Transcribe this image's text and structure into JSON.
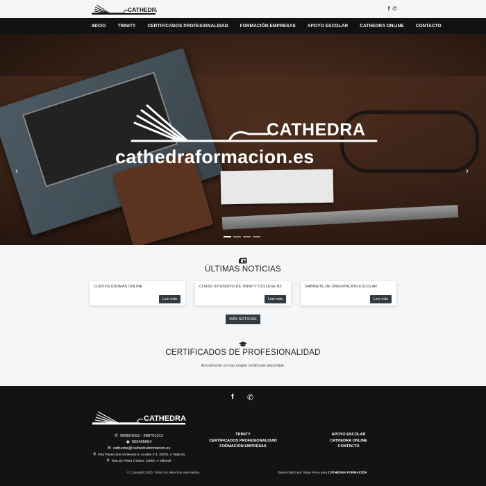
{
  "header": {
    "logo_text": "CATHEDRA",
    "social": [
      {
        "icon": "facebook-icon",
        "glyph": "f"
      },
      {
        "icon": "whatsapp-icon",
        "glyph": "✆"
      }
    ]
  },
  "nav": {
    "items": [
      {
        "label": "INICIO"
      },
      {
        "label": "TRINITY"
      },
      {
        "label": "CERTIFICADOS PROFESIONALIDAD"
      },
      {
        "label": "FORMACIÓN EMPRESAS"
      },
      {
        "label": "APOYO ESCOLAR"
      },
      {
        "label": "CATHEDRA ONLINE"
      },
      {
        "label": "CONTACTO"
      }
    ]
  },
  "hero": {
    "brand": "CATHEDRA",
    "url": "cathedraformacion.es",
    "prev_glyph": "‹",
    "next_glyph": "›",
    "slide_count": 4,
    "active_slide": 1
  },
  "news": {
    "title": "ÚLTIMAS NOTICIAS",
    "cards": [
      {
        "title": "CURSOS IDIOMAS ONLINE",
        "button": "Leer más"
      },
      {
        "title": "CURSO INTENSIVO DE TRINITY COLLEGE B2",
        "button": "Leer más"
      },
      {
        "title": "GABINETE DE ORIENTACIÓN ESCOLAR",
        "button": "Leer más"
      }
    ],
    "more_button": "MÁS NOTICIAS"
  },
  "certificates": {
    "title": "CERTIFICADOS DE PROFESIONALIDAD",
    "empty_message": "Actualmente no hay ningún certificado disponible."
  },
  "footer": {
    "logo_text": "CATHEDRA",
    "phone": "988601652 - 988701312",
    "whatsapp": "659405054",
    "email": "cathedra@cathedraformacion.es",
    "address1": "Rúa Paseo dos Anmieiros 5, locales 3-4, 32002, A Valenzá",
    "address2": "Rúa da Presa 2 baixo, 32002, A Valenzá",
    "links_col1": [
      "TRINITY",
      "CERTIFICADOS PROFESIONALIDAD",
      "FORMACIÓN EMPRESAS"
    ],
    "links_col2": [
      "APOYO ESCOLAR",
      "CATHEDRA ONLINE",
      "CONTACTO"
    ],
    "copyright": "© Copyright 2020, Todos los derechos reservados.",
    "developed_prefix": "Desarrollado por Diego Pena para",
    "developed_brand": "CATHEDRA FORMACIÓN"
  },
  "colors": {
    "navbar": "#111214",
    "footer": "#121315",
    "button": "#333a40",
    "page_bg": "#f5f6f8"
  }
}
